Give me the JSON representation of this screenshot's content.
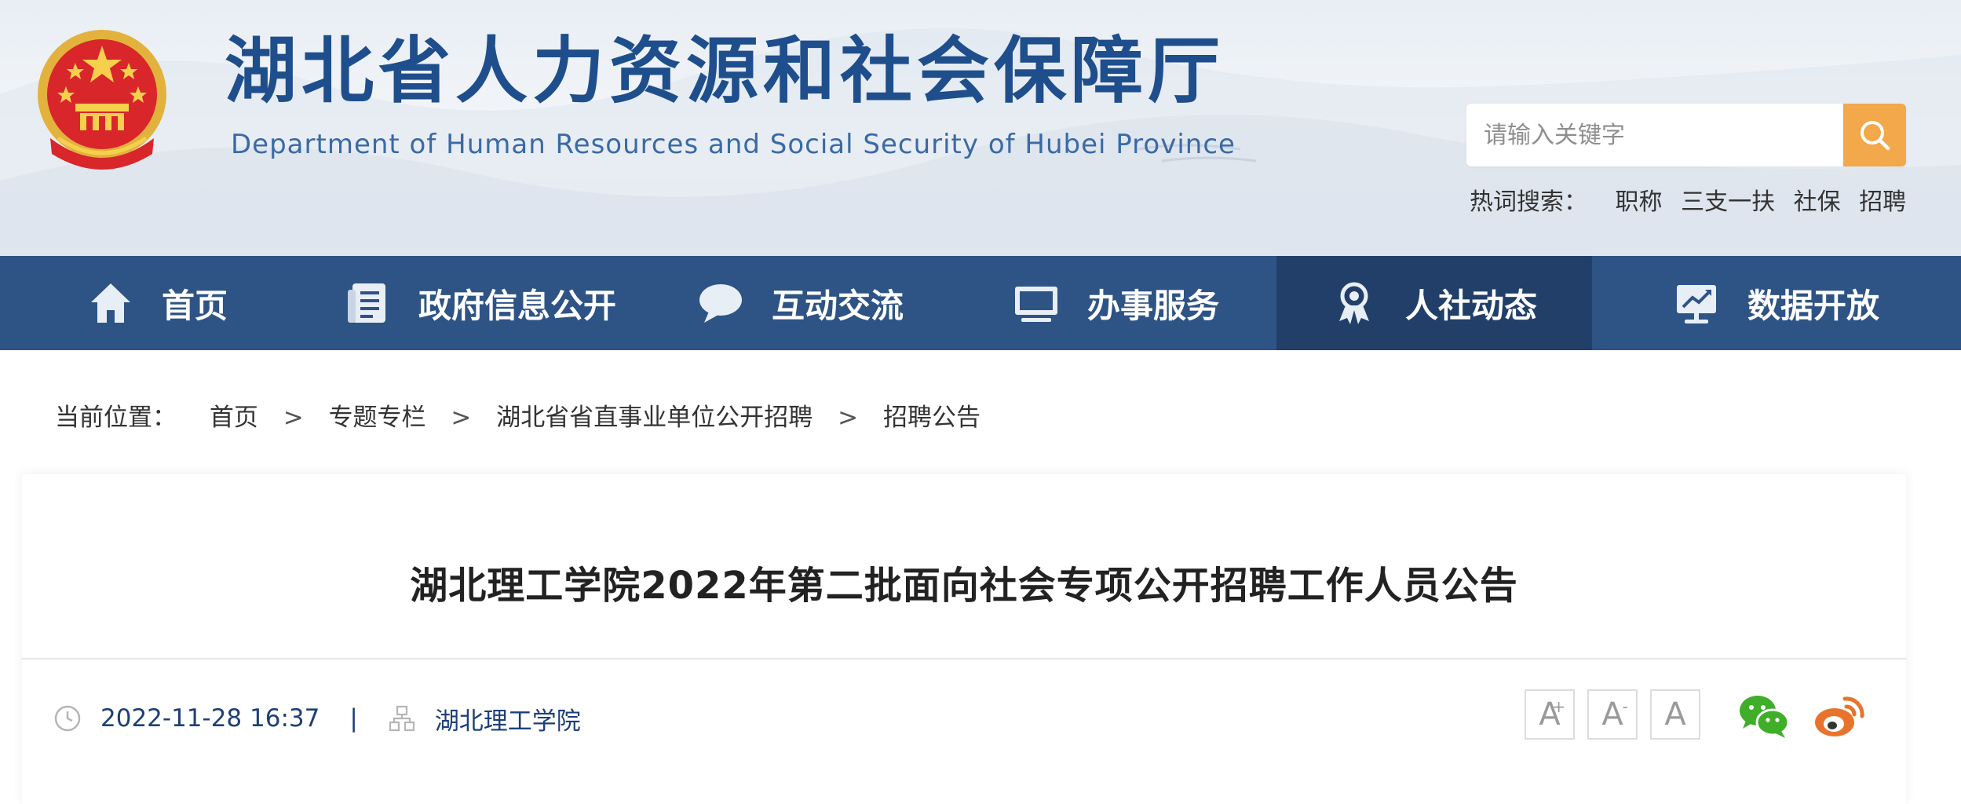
{
  "header": {
    "title": "湖北省人力资源和社会保障厅",
    "subtitle": "Department of Human Resources and Social Security of Hubei Province",
    "search": {
      "placeholder": "请输入关键字",
      "button_icon": "search-icon"
    },
    "hot_words": {
      "label": "热词搜索：",
      "items": [
        "职称",
        "三支一扶",
        "社保",
        "招聘"
      ]
    }
  },
  "nav": {
    "items": [
      {
        "label": "首页",
        "icon": "home-icon",
        "active": false
      },
      {
        "label": "政府信息公开",
        "icon": "document-icon",
        "active": false
      },
      {
        "label": "互动交流",
        "icon": "chat-bubble-icon",
        "active": false
      },
      {
        "label": "办事服务",
        "icon": "monitor-icon",
        "active": false
      },
      {
        "label": "人社动态",
        "icon": "award-person-icon",
        "active": true
      },
      {
        "label": "数据开放",
        "icon": "chart-screen-icon",
        "active": false
      }
    ]
  },
  "breadcrumb": {
    "label": "当前位置：",
    "items": [
      "首页",
      "专题专栏",
      "湖北省省直事业单位公开招聘",
      "招聘公告"
    ],
    "separator": ">"
  },
  "article": {
    "title": "湖北理工学院2022年第二批面向社会专项公开招聘工作人员公告",
    "date": "2022-11-28 16:37",
    "meta_separator": "|",
    "source": "湖北理工学院",
    "font_sizes": [
      {
        "label": "A",
        "sup": "+"
      },
      {
        "label": "A",
        "sup": "-"
      },
      {
        "label": "A",
        "sup": ""
      }
    ],
    "share": [
      "wechat-icon",
      "weibo-icon"
    ]
  },
  "colors": {
    "nav_bg": "#2e5385",
    "nav_active_bg": "#213f69",
    "title_blue": "#1f4e8c",
    "search_button": "#f2a84b",
    "meta_text": "#1d3f78",
    "wechat_green": "#3fae29",
    "weibo_orange": "#e8742c"
  }
}
